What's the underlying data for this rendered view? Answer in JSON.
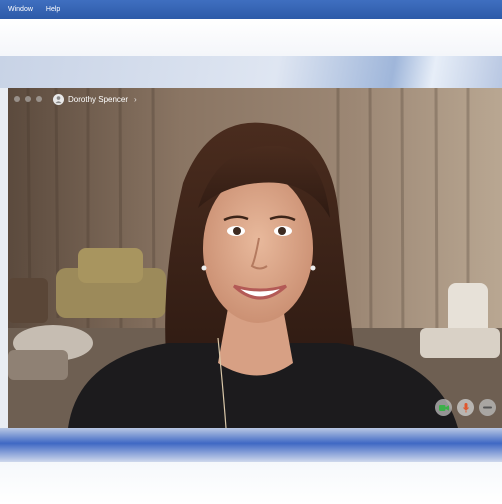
{
  "menubar": {
    "items": [
      "Window",
      "Help"
    ]
  },
  "call": {
    "caller_name": "Dorothy Spencer",
    "chevron": "›",
    "icons": {
      "avatar": "person-avatar-icon",
      "camera": "video-camera-icon",
      "mic": "microphone-icon",
      "more": "more-icon"
    }
  },
  "colors": {
    "menubar": "#2d5aa8",
    "camera_button": "#3cb04a",
    "mic_button": "#e0562c"
  }
}
